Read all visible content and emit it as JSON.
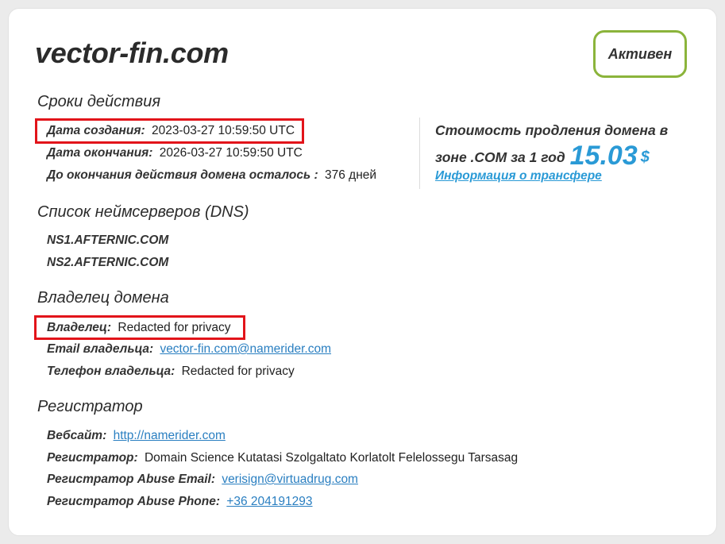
{
  "domain": "vector-fin.com",
  "status": "Активен",
  "validity": {
    "title": "Сроки действия",
    "created_label": "Дата создания:",
    "created_value": "2023-03-27 10:59:50 UTC",
    "expires_label": "Дата окончания:",
    "expires_value": "2026-03-27 10:59:50 UTC",
    "remaining_label": "До окончания действия домена осталось :",
    "remaining_value": "376 дней"
  },
  "renewal": {
    "text": "Стоимость продления домена в зоне .COM за 1 год",
    "price": "15.03",
    "currency": "$",
    "transfer_link": "Информация о трансфере"
  },
  "dns": {
    "title": "Список неймсерверов (DNS)",
    "servers": [
      "NS1.AFTERNIC.COM",
      "NS2.AFTERNIC.COM"
    ]
  },
  "owner": {
    "title": "Владелец домена",
    "owner_label": "Владелец:",
    "owner_value": "Redacted for privacy",
    "email_label": "Email владельца:",
    "email_value": "vector-fin.com@namerider.com",
    "phone_label": "Телефон владельца:",
    "phone_value": "Redacted for privacy"
  },
  "registrar": {
    "title": "Регистратор",
    "website_label": "Вебсайт:",
    "website_value": "http://namerider.com",
    "name_label": "Регистратор:",
    "name_value": "Domain Science Kutatasi Szolgaltato Korlatolt Felelossegu Tarsasag",
    "abuse_email_label": "Регистратор Abuse Email:",
    "abuse_email_value": "verisign@virtuadrug.com",
    "abuse_phone_label": "Регистратор Abuse Phone:",
    "abuse_phone_value": "+36 204191293"
  },
  "colors": {
    "accent_blue": "#2a9ad6",
    "badge_border": "#8bb43b",
    "highlight_red": "#e2141a"
  }
}
